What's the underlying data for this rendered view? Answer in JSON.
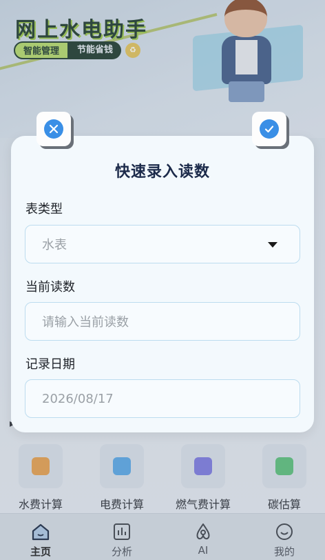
{
  "banner": {
    "title": "网上水电助手",
    "tag_left": "智能管理",
    "tag_right": "节能省钱",
    "coin_glyph": "♻"
  },
  "modal": {
    "title": "快速录入读数",
    "meter_type": {
      "label": "表类型",
      "value": "水表"
    },
    "reading": {
      "label": "当前读数",
      "placeholder": "请输入当前读数"
    },
    "date": {
      "label": "记录日期",
      "value": "2026/08/17"
    }
  },
  "tools": [
    {
      "label": "水费计算",
      "icon": "water-fee-icon",
      "color": "#e7a04e"
    },
    {
      "label": "电费计算",
      "icon": "electric-fee-icon",
      "color": "#5aa8e6"
    },
    {
      "label": "燃气费计算",
      "icon": "gas-fee-icon",
      "color": "#7d7be0"
    },
    {
      "label": "碳估算",
      "icon": "carbon-icon",
      "color": "#5cc07a"
    }
  ],
  "tabbar": [
    {
      "label": "主页",
      "icon": "home-icon",
      "active": true
    },
    {
      "label": "分析",
      "icon": "chart-icon",
      "active": false
    },
    {
      "label": "AI",
      "icon": "ai-icon",
      "active": false
    },
    {
      "label": "我的",
      "icon": "smile-icon",
      "active": false
    }
  ],
  "colors": {
    "accent": "#3a8fe6",
    "modal_bg": "#f3f9fd",
    "field_border": "#bcdcef"
  }
}
